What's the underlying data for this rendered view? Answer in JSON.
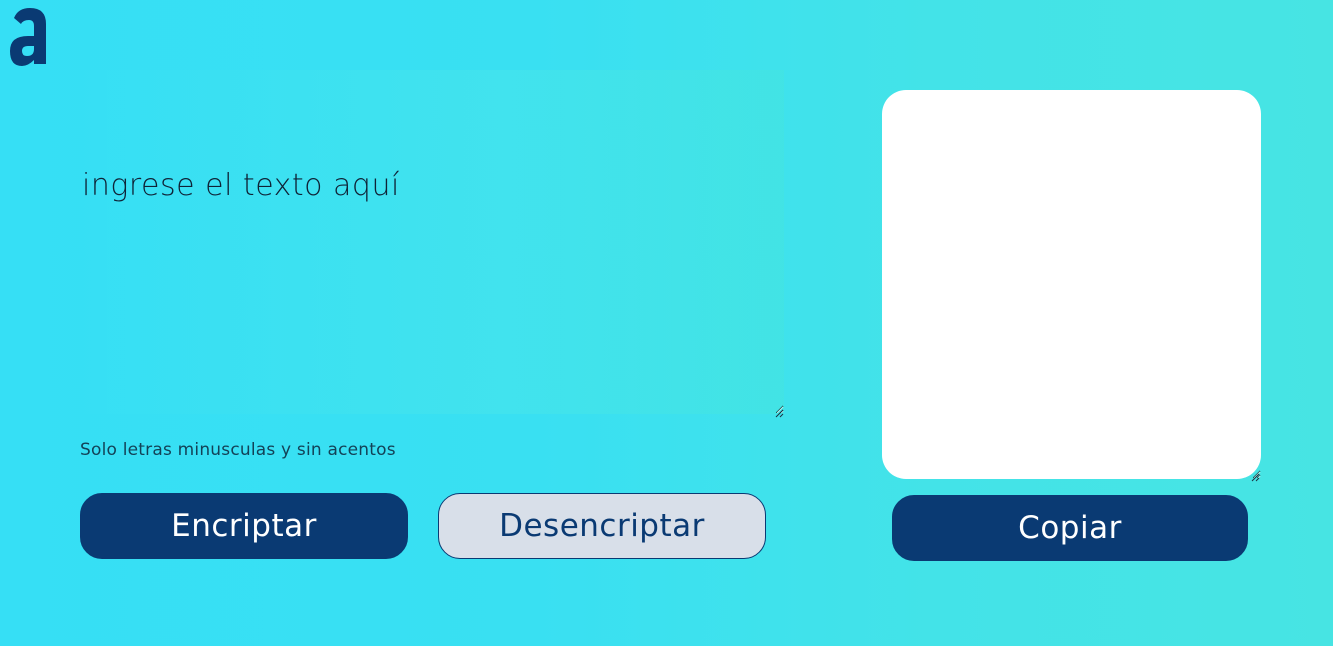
{
  "logo": {
    "icon": "alura-logo-icon",
    "color": "#0a3a73"
  },
  "input": {
    "placeholder": "ingrese el texto aquí",
    "value": ""
  },
  "hint": {
    "text": "Solo letras minusculas y sin acentos"
  },
  "buttons": {
    "encrypt_label": "Encriptar",
    "decrypt_label": "Desencriptar",
    "copy_label": "Copiar"
  },
  "output": {
    "value": ""
  },
  "colors": {
    "primary": "#0a3a73",
    "secondary_bg": "#d8dfe9",
    "background": "#3ae0f2",
    "output_bg": "#ffffff"
  }
}
